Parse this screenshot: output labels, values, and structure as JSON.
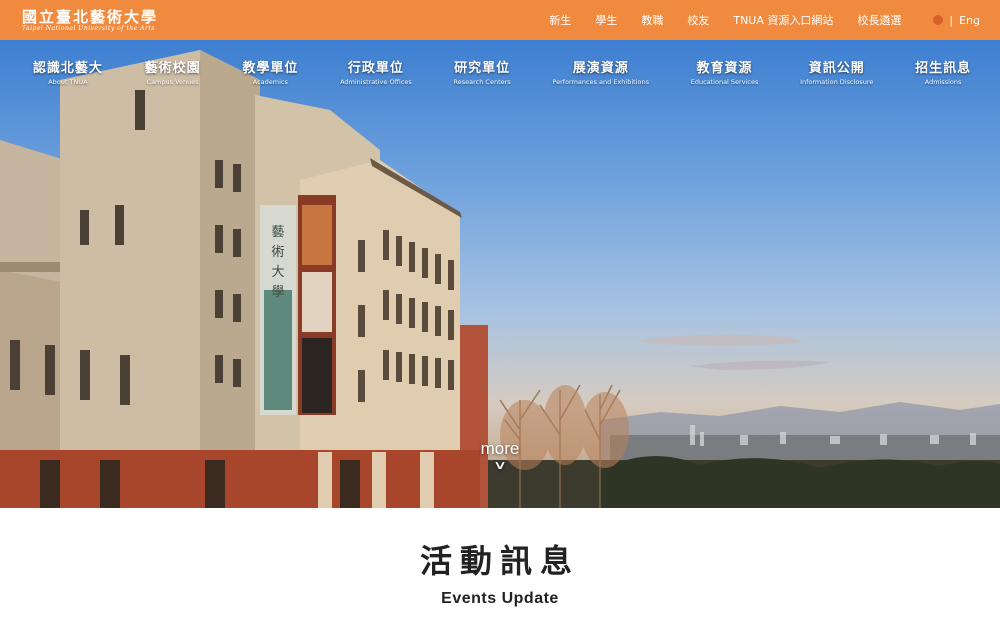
{
  "header": {
    "logo_cn": "國立臺北藝術大學",
    "logo_en": "Taipei National University of the Arts",
    "utility_links": [
      "新生",
      "學生",
      "教職",
      "校友",
      "TNUA 資源入口網站",
      "校長遴選"
    ],
    "language_label": "Eng"
  },
  "nav": {
    "items": [
      {
        "cn": "認識北藝大",
        "en": "About TNUA"
      },
      {
        "cn": "藝術校園",
        "en": "Campus Venues"
      },
      {
        "cn": "教學單位",
        "en": "Academics"
      },
      {
        "cn": "行政單位",
        "en": "Administrative Offices"
      },
      {
        "cn": "研究單位",
        "en": "Research Centers"
      },
      {
        "cn": "展演資源",
        "en": "Performances and Exhibitions"
      },
      {
        "cn": "教育資源",
        "en": "Educational Services"
      },
      {
        "cn": "資訊公開",
        "en": "Information Disclosure"
      },
      {
        "cn": "招生訊息",
        "en": "Admissions"
      }
    ]
  },
  "hero": {
    "more_label": "more",
    "banner_text": "藝術大學"
  },
  "events": {
    "title": "活動訊息",
    "subtitle": "Events Update"
  },
  "colors": {
    "brand_orange": "#f08a3e",
    "sky_top": "#3d7fd1",
    "building": "#c8b49c",
    "brick": "#b44a2c"
  }
}
